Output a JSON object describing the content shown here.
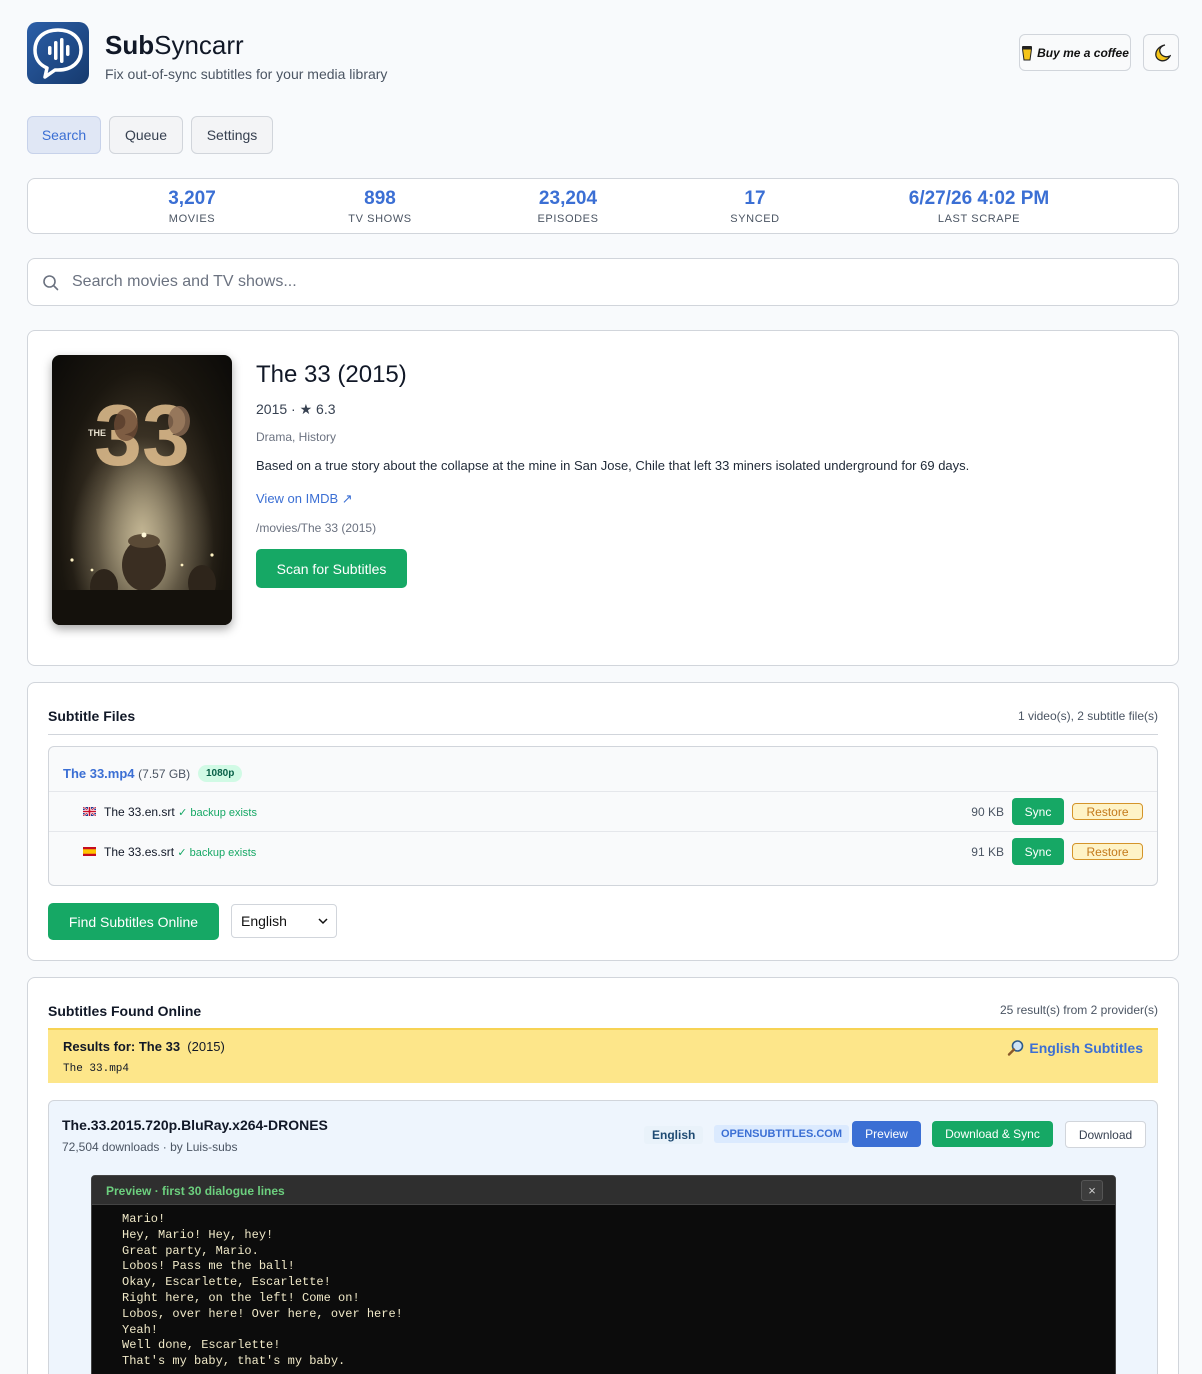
{
  "app": {
    "title_bold": "Sub",
    "title_rest": "Syncarr",
    "subtitle": "Fix out-of-sync subtitles for your media library",
    "coffee_label": "Buy me a coffee"
  },
  "nav": {
    "search": "Search",
    "queue": "Queue",
    "settings": "Settings"
  },
  "stats": [
    {
      "value": "3,207",
      "label": "MOVIES"
    },
    {
      "value": "898",
      "label": "TV SHOWS"
    },
    {
      "value": "23,204",
      "label": "EPISODES"
    },
    {
      "value": "17",
      "label": "SYNCED"
    },
    {
      "value": "6/27/26 4:02 PM",
      "label": "LAST SCRAPE"
    }
  ],
  "search": {
    "placeholder": "Search movies and TV shows..."
  },
  "movie": {
    "poster_text_small": "THE",
    "poster_text_big": "33",
    "title": "The 33 (2015)",
    "meta": "2015 · ★ 6.3",
    "genres": "Drama, History",
    "plot": "Based on a true story about the collapse at the mine in San Jose, Chile that left 33 miners isolated underground for 69 days.",
    "imdb_link": "View on IMDB ↗",
    "path": "/movies/The 33 (2015)",
    "scan_button": "Scan for Subtitles"
  },
  "subtitle_files": {
    "title": "Subtitle Files",
    "summary": "1 video(s), 2 subtitle file(s)",
    "video_name": "The 33.mp4",
    "video_size": "(7.57 GB)",
    "video_res": "1080p",
    "files": [
      {
        "name": "The 33.en.srt",
        "backup": "✓ backup exists",
        "size": "90 KB",
        "sync": "Sync",
        "restore": "Restore"
      },
      {
        "name": "The 33.es.srt",
        "backup": "✓ backup exists",
        "size": "91 KB",
        "sync": "Sync",
        "restore": "Restore"
      }
    ],
    "find_button": "Find Subtitles Online",
    "language": "English"
  },
  "online": {
    "title": "Subtitles Found Online",
    "summary": "25 result(s) from 2 provider(s)",
    "results_for_label": "Results for:",
    "results_for_title": "The 33",
    "results_for_year": "(2015)",
    "results_file": "The 33.mp4",
    "english_link": "English Subtitles",
    "result": {
      "name": "The.33.2015.720p.BluRay.x264-DRONES",
      "meta": "72,504 downloads · by Luis-subs",
      "language": "English",
      "provider": "OPENSUBTITLES.COM",
      "preview_button": "Preview",
      "download_sync_button": "Download & Sync",
      "download_button": "Download"
    },
    "preview": {
      "header": "Preview · first 30 dialogue lines",
      "close": "×",
      "lines": [
        "Mario!",
        "Hey, Mario! Hey, hey!",
        "Great party, Mario.",
        "Lobos! Pass me the ball!",
        "Okay, Escarlette, Escarlette!",
        "Right here, on the left! Come on!",
        "Lobos, over here! Over here, over here!",
        "Yeah!",
        "Well done, Escarlette!",
        "That's my baby, that's my baby."
      ]
    }
  },
  "colors": {
    "accent": "#3b6fd4",
    "green": "#16a865",
    "banner": "#fde68a"
  }
}
